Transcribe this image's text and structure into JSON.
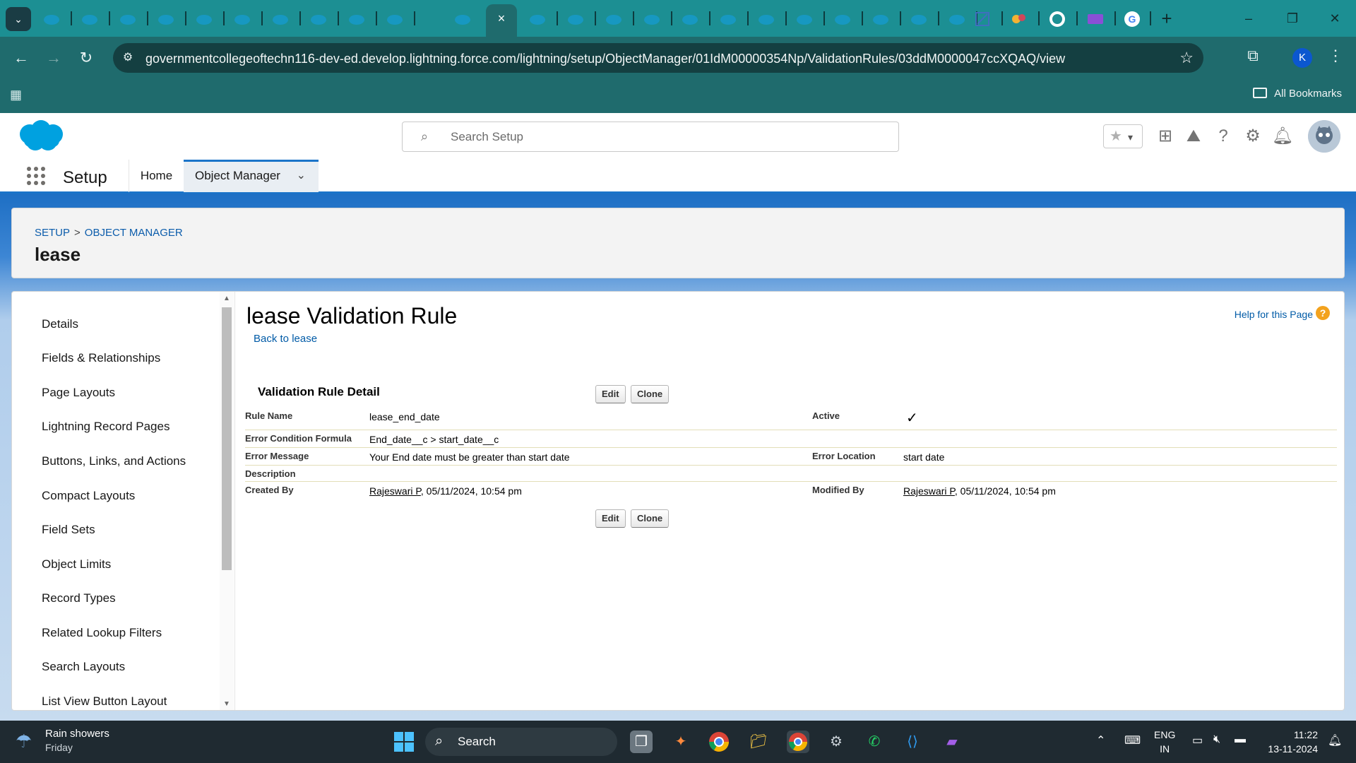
{
  "browser": {
    "active_tab_close": "×",
    "new_tab": "+",
    "url": "governmentcollegeoftechn116-dev-ed.develop.lightning.force.com/lightning/setup/ObjectManager/01IdM00000354Np/ValidationRules/03ddM0000047ccXQAQ/view",
    "profile_initial": "K",
    "all_bookmarks": "All Bookmarks"
  },
  "sf_header": {
    "search_placeholder": "Search Setup"
  },
  "app_nav": {
    "app_name": "Setup",
    "home": "Home",
    "object_manager": "Object Manager"
  },
  "page_header": {
    "breadcrumb_setup": "SETUP",
    "breadcrumb_sep": ">",
    "breadcrumb_object_manager": "OBJECT MANAGER",
    "object_title": "lease"
  },
  "left_nav": {
    "items": [
      "Details",
      "Fields & Relationships",
      "Page Layouts",
      "Lightning Record Pages",
      "Buttons, Links, and Actions",
      "Compact Layouts",
      "Field Sets",
      "Object Limits",
      "Record Types",
      "Related Lookup Filters",
      "Search Layouts",
      "List View Button Layout"
    ]
  },
  "detail": {
    "page_title": "lease Validation Rule",
    "back_link": "Back to lease",
    "help_link": "Help for this Page",
    "section_title": "Validation Rule Detail",
    "edit_label": "Edit",
    "clone_label": "Clone",
    "fields": {
      "rule_name_label": "Rule Name",
      "rule_name_value": "lease_end_date",
      "active_label": "Active",
      "active_value": "✓",
      "formula_label": "Error Condition Formula",
      "formula_value": "End_date__c > start_date__c",
      "error_message_label": "Error Message",
      "error_message_value": "Your End date must be greater than start date",
      "error_location_label": "Error Location",
      "error_location_value": "start date",
      "description_label": "Description",
      "created_by_label": "Created By",
      "created_by_user": "Rajeswari P",
      "created_by_date": ", 05/11/2024, 10:54 pm",
      "modified_by_label": "Modified By",
      "modified_by_user": "Rajeswari P",
      "modified_by_date": ", 05/11/2024, 10:54 pm"
    }
  },
  "taskbar": {
    "weather_title": "Rain showers",
    "weather_day": "Friday",
    "search_label": "Search",
    "lang_line1": "ENG",
    "lang_line2": "IN",
    "time": "11:22",
    "date": "13-11-2024"
  },
  "colors": {
    "tab_strip": "#1c8f93",
    "browser_toolbar": "#1f6b6d",
    "sf_brand_blue": "#1b74c9",
    "link_blue": "#015ba7",
    "help_orange": "#f3a21d",
    "taskbar": "#1f2a31"
  },
  "icons": {
    "tab_favicon": "salesforce-cloud-icon",
    "search": "search-icon",
    "settings": "gear-icon",
    "notifications": "bell-icon",
    "help": "question-icon"
  }
}
